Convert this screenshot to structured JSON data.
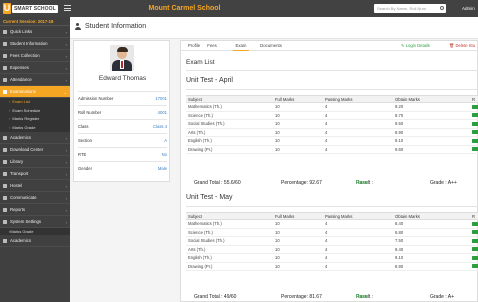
{
  "header": {
    "logo_letter": "U",
    "logo_text": "SMART SCHOOL",
    "school_name": "Mount Carmel School",
    "search_placeholder": "Search By Name, Roll Num",
    "user_label": "Admin"
  },
  "sidebar": {
    "session": "Current Session: 2017-18",
    "items": [
      {
        "label": "Quick Links",
        "icon": "link-icon"
      },
      {
        "label": "Student Information",
        "icon": "users-icon"
      },
      {
        "label": "Fees Collection",
        "icon": "money-icon"
      },
      {
        "label": "Expenses",
        "icon": "credit-card-icon"
      },
      {
        "label": "Attendance",
        "icon": "calendar-check-icon"
      },
      {
        "label": "Examinations",
        "icon": "map-icon"
      }
    ],
    "sub_items": [
      "Exam List",
      "Exam Schedule",
      "Marks Register",
      "Marks Grade"
    ],
    "items_after": [
      {
        "label": "Academics",
        "icon": "mortar-board-icon"
      },
      {
        "label": "Download Center",
        "icon": "download-icon"
      },
      {
        "label": "Library",
        "icon": "book-icon"
      },
      {
        "label": "Transport",
        "icon": "bus-icon"
      },
      {
        "label": "Hostel",
        "icon": "building-icon"
      },
      {
        "label": "Communicate",
        "icon": "bullhorn-icon"
      },
      {
        "label": "Reports",
        "icon": "line-chart-icon"
      },
      {
        "label": "System Settings",
        "icon": "gears-icon"
      }
    ],
    "bottom_sub": "Marks Grade",
    "bottom_item": {
      "label": "Academics",
      "icon": "mortar-board-icon"
    }
  },
  "page": {
    "title": "Student Information"
  },
  "student": {
    "name": "Edward Thomas",
    "fields": [
      {
        "label": "Admission Number",
        "value": "17001"
      },
      {
        "label": "Roll Number",
        "value": "4001"
      },
      {
        "label": "Class",
        "value": "Class 4"
      },
      {
        "label": "Section",
        "value": "A"
      },
      {
        "label": "RTE",
        "value": "No"
      },
      {
        "label": "Gender",
        "value": "Male"
      }
    ]
  },
  "tabs": {
    "items": [
      "Profile",
      "Fees",
      "Exam",
      "Documents"
    ],
    "active": "Exam",
    "login_details": "Login Details",
    "delete_student": "Delete Stu"
  },
  "exam_list_title": "Exam List",
  "table_columns": [
    "Subject",
    "Full Marks",
    "Passing Marks",
    "Obtain Marks",
    "R"
  ],
  "exams": [
    {
      "title": "Unit Test - April",
      "rows": [
        [
          "Mathematics (Th.)",
          "10",
          "4",
          "9.20"
        ],
        [
          "Science (Th.)",
          "10",
          "4",
          "8.70"
        ],
        [
          "Social Studies (Th.)",
          "10",
          "4",
          "9.50"
        ],
        [
          "Arts (Th.)",
          "10",
          "4",
          "8.90"
        ],
        [
          "English (Th.)",
          "10",
          "4",
          "9.10"
        ],
        [
          "Drawing (Pr.)",
          "10",
          "4",
          "9.60"
        ]
      ],
      "grand_total": "Grand Total : 55.6/60",
      "percentage": "Percentage: 92.67",
      "result_label": "Result :",
      "result_value": "Pass",
      "grade": "Grade : A++"
    },
    {
      "title": "Unit Test - May",
      "rows": [
        [
          "Mathematics (Th.)",
          "10",
          "4",
          "8.40"
        ],
        [
          "Science (Th.)",
          "10",
          "4",
          "6.80"
        ],
        [
          "Social Studies (Th.)",
          "10",
          "4",
          "7.50"
        ],
        [
          "Arts (Th.)",
          "10",
          "4",
          "8.40"
        ],
        [
          "English (Th.)",
          "10",
          "4",
          "9.10"
        ],
        [
          "Drawing (Pr.)",
          "10",
          "4",
          "8.90"
        ]
      ],
      "grand_total": "Grand Total : 49/60",
      "percentage": "Percentage: 81.67",
      "result_label": "Result :",
      "result_value": "Pass",
      "grade": "Grade : A+"
    }
  ],
  "colors": {
    "accent": "#f5a623",
    "topbar": "#424242",
    "sidebar": "#404040",
    "pass": "#2e9d3e",
    "link": "#3a7fc4"
  }
}
